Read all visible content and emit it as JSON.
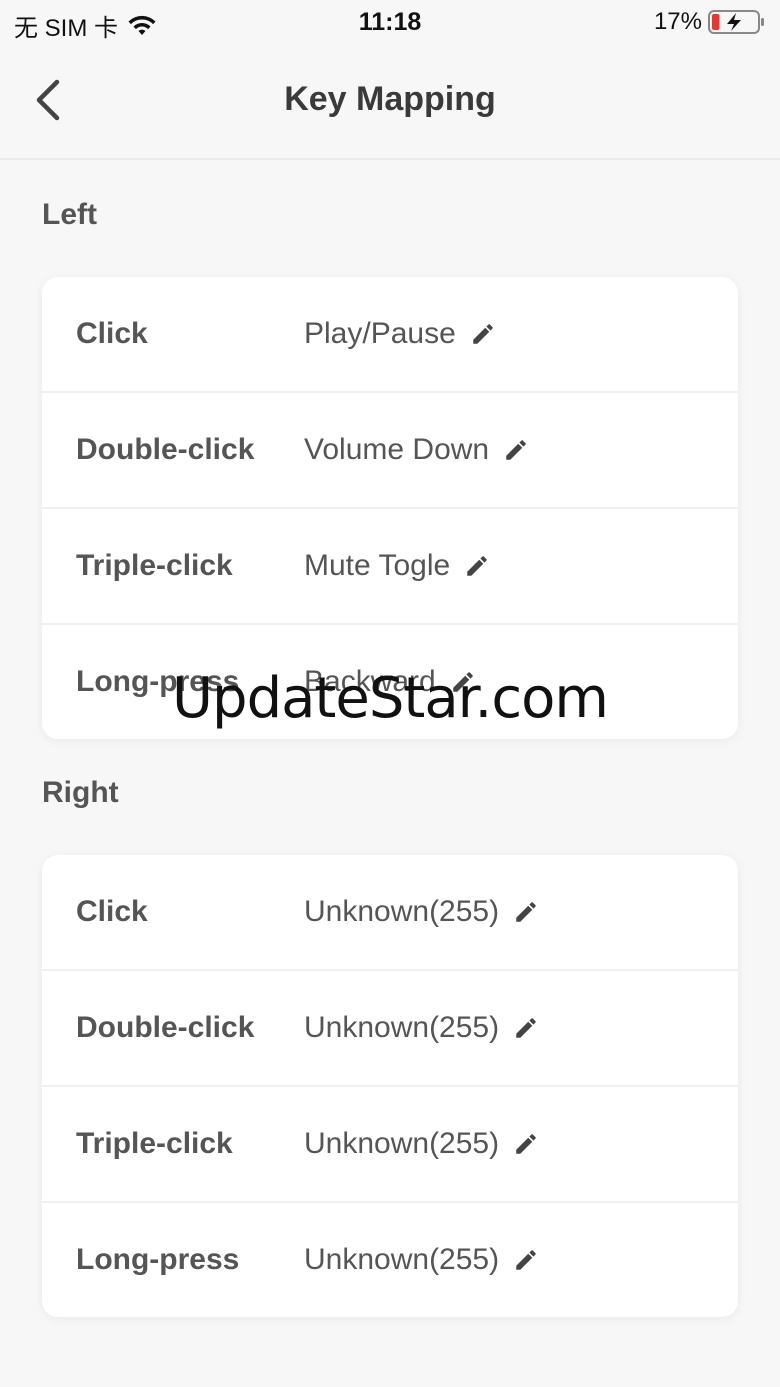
{
  "status_bar": {
    "carrier": "无 SIM 卡",
    "time": "11:18",
    "battery_percent": "17%",
    "battery_level": 0.17,
    "battery_color": "#e53935"
  },
  "header": {
    "title": "Key Mapping"
  },
  "sections": [
    {
      "title": "Left",
      "rows": [
        {
          "label": "Click",
          "value": "Play/Pause"
        },
        {
          "label": "Double-click",
          "value": "Volume Down"
        },
        {
          "label": "Triple-click",
          "value": "Mute Togle"
        },
        {
          "label": "Long-press",
          "value": "Backward"
        }
      ]
    },
    {
      "title": "Right",
      "rows": [
        {
          "label": "Click",
          "value": "Unknown(255)"
        },
        {
          "label": "Double-click",
          "value": "Unknown(255)"
        },
        {
          "label": "Triple-click",
          "value": "Unknown(255)"
        },
        {
          "label": "Long-press",
          "value": "Unknown(255)"
        }
      ]
    }
  ],
  "watermark": "UpdateStar.com",
  "icons": {
    "back": "chevron-left-icon",
    "edit": "pencil-icon",
    "wifi": "wifi-icon",
    "battery": "battery-charging-icon"
  }
}
